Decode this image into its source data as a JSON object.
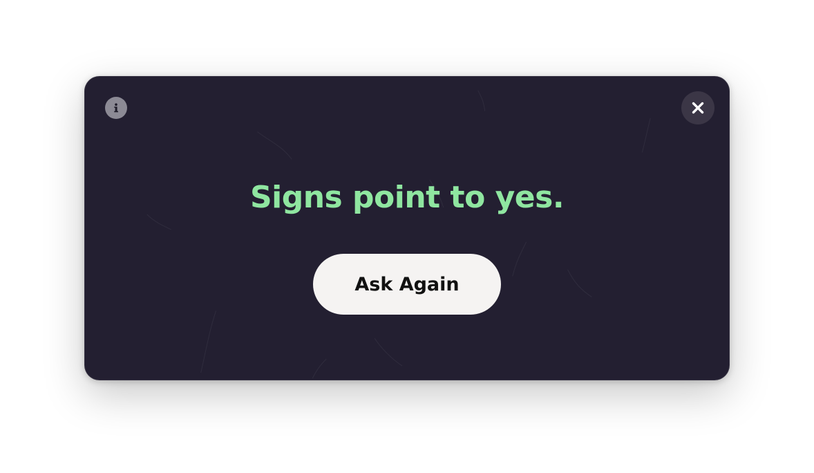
{
  "dialog": {
    "answer_text": "Signs point to yes.",
    "ask_again_label": "Ask Again",
    "info_icon": "info-icon",
    "close_icon": "close-icon"
  },
  "colors": {
    "window_background": "#231f31",
    "answer_text": "#8fe6a0",
    "button_background": "#f5f3f2",
    "button_text": "#111111",
    "info_icon_background": "#8c8a95",
    "close_button_background": "#3b3646"
  }
}
